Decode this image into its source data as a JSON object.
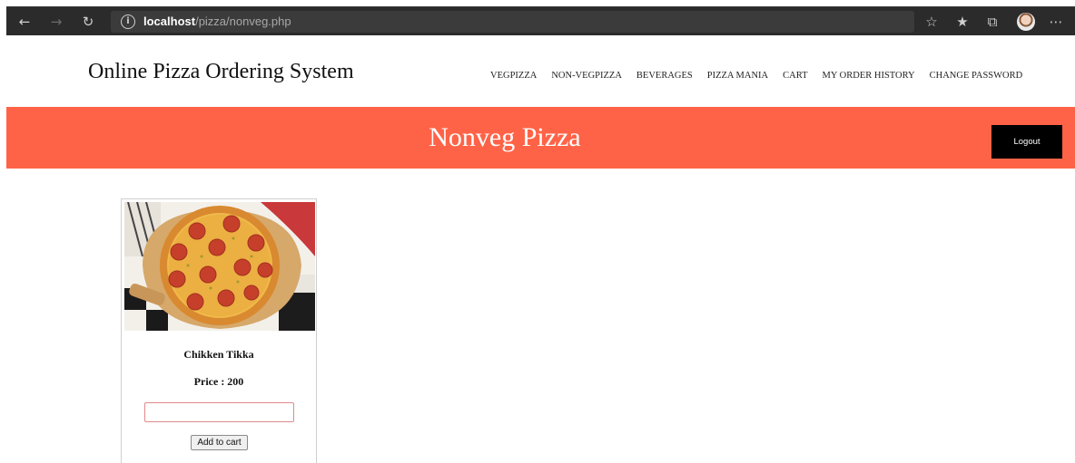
{
  "browser": {
    "url_host": "localhost",
    "url_path": "/pizza/nonveg.php",
    "icons": [
      "back-icon",
      "forward-icon",
      "refresh-icon",
      "info-icon",
      "favorite-star-icon",
      "favorites-list-icon",
      "collections-icon",
      "profile-avatar",
      "more-icon"
    ]
  },
  "site": {
    "title": "Online Pizza Ordering System",
    "nav": [
      "VEGPIZZA",
      "NON-VEGPIZZA",
      "BEVERAGES",
      "PIZZA MANIA",
      "CART",
      "MY ORDER HISTORY",
      "CHANGE PASSWORD"
    ]
  },
  "banner": {
    "title": "Nonveg Pizza",
    "logout_label": "Logout",
    "color": "#ff6347"
  },
  "product": {
    "name": "Chikken Tikka",
    "price_label": "Price : 200",
    "quantity_value": "",
    "add_to_cart_label": "Add to cart"
  }
}
